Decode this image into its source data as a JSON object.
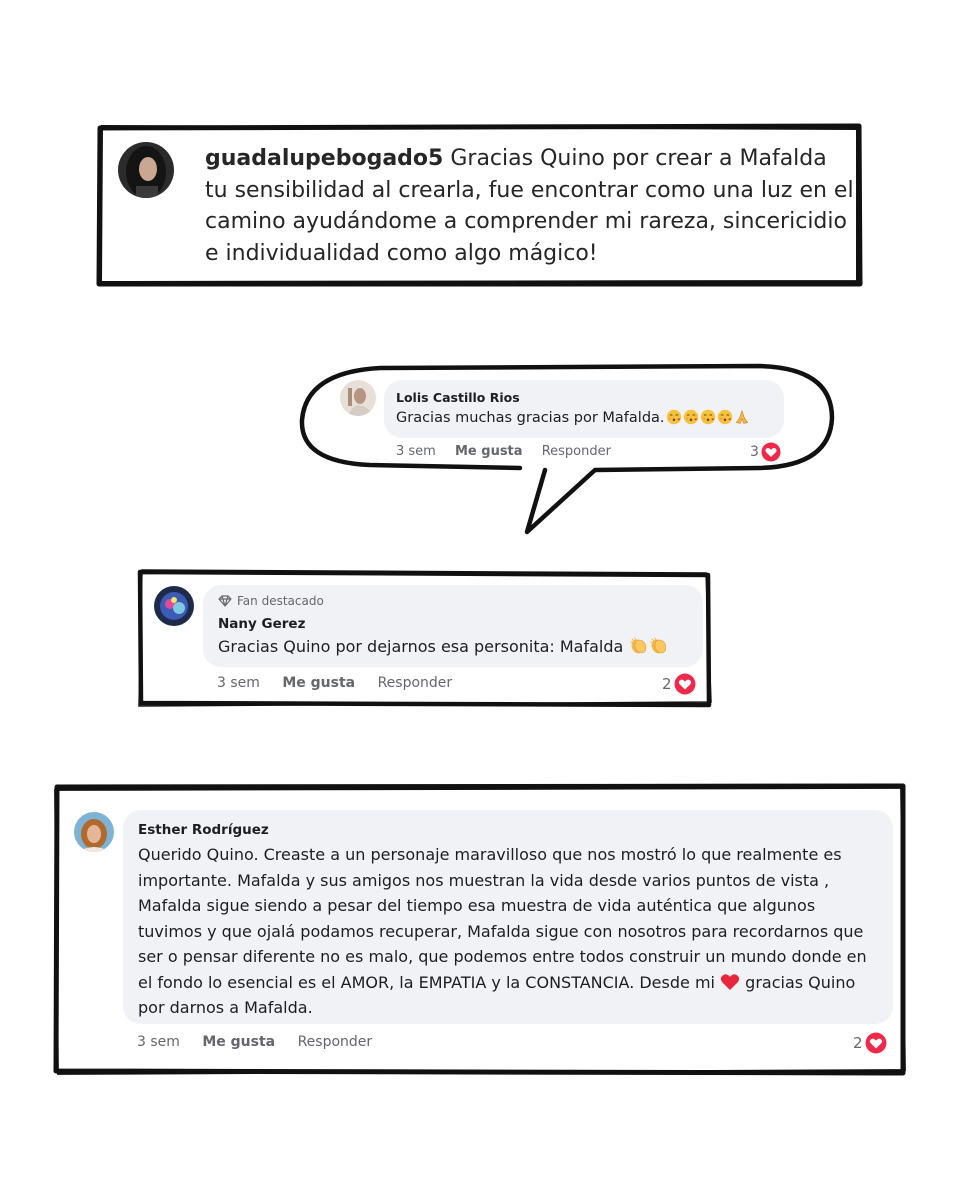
{
  "comments": [
    {
      "username": "guadalupebogado5",
      "text": "Gracias Quino por crear a Mafalda tu sensibilidad al crearla, fue encontrar como una luz en el camino ayudándome a comprender mi rareza, sincericidio e individualidad como algo mágico!",
      "avatar_icon": "avatar-dark-hair"
    },
    {
      "name": "Lolis Castillo Rios",
      "text": "Gracias muchas gracias por Mafalda.",
      "emojis": [
        "kissing-face-emoji",
        "kissing-face-emoji",
        "kissing-face-emoji",
        "kissing-face-emoji",
        "folded-hands-emoji"
      ],
      "time": "3 sem",
      "like_label": "Me gusta",
      "reply_label": "Responder",
      "reaction_count": "3",
      "reaction_icon": "heart-icon"
    },
    {
      "badge": "Fan destacado",
      "badge_icon": "diamond-icon",
      "name": "Nany Gerez",
      "text": "Gracias Quino por dejarnos esa personita: Mafalda",
      "emojis": [
        "clapping-hands-emoji",
        "clapping-hands-emoji"
      ],
      "time": "3 sem",
      "like_label": "Me gusta",
      "reply_label": "Responder",
      "reaction_count": "2",
      "reaction_icon": "heart-icon"
    },
    {
      "name": "Esther Rodríguez",
      "text": "Querido Quino. Creaste a un personaje maravilloso que nos mostró lo que realmente es importante. Mafalda y sus amigos nos muestran la vida desde varios puntos de vista , Mafalda sigue siendo a pesar del tiempo esa muestra de vida auténtica que algunos tuvimos y que ojalá podamos recuperar, Mafalda sigue con nosotros para recordarnos que ser o pensar diferente no es malo, que podemos entre todos construir un mundo donde en el fondo lo esencial es el AMOR, la EMPATIA y la CONSTANCIA. Desde mi",
      "text_end": "gracias Quino por darnos a Mafalda.",
      "inline_emoji": "red-heart-emoji",
      "time": "3 sem",
      "like_label": "Me gusta",
      "reply_label": "Responder",
      "reaction_count": "2",
      "reaction_icon": "heart-icon"
    }
  ],
  "colors": {
    "bubble": "#f0f2f5",
    "meta": "#65676b",
    "heart": "#f0284a",
    "border": "#111111"
  }
}
